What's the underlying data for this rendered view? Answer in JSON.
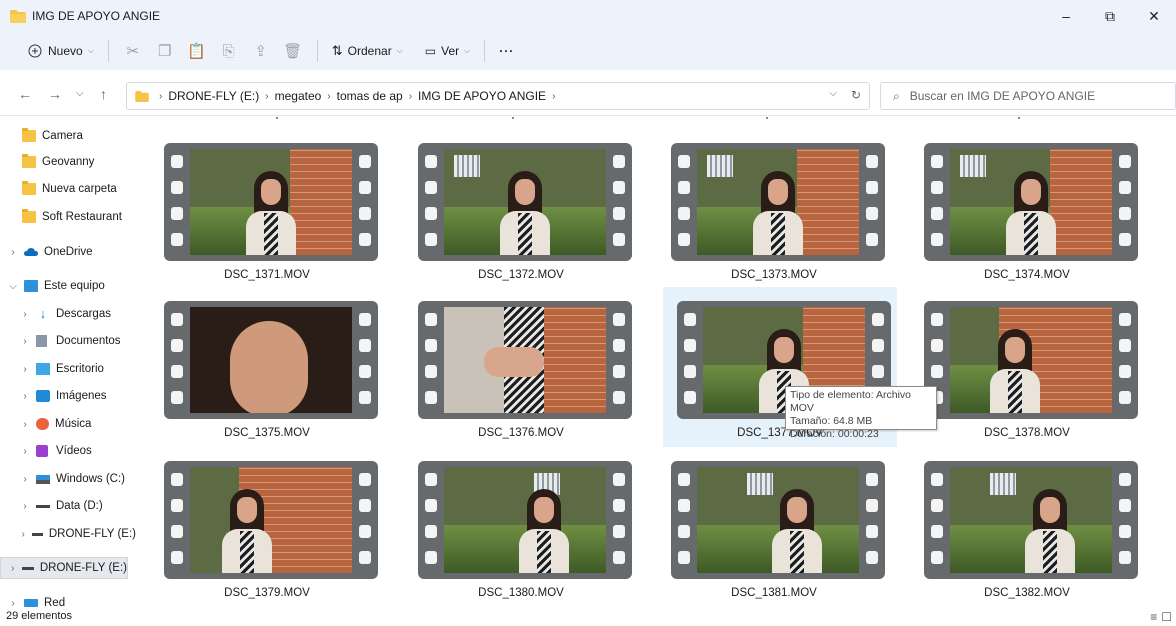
{
  "window": {
    "title": "IMG DE APOYO ANGIE",
    "minimize": "–",
    "restore": "⧉",
    "close": "✕"
  },
  "toolbar": {
    "new_label": "Nuevo",
    "sort_label": "Ordenar",
    "view_label": "Ver",
    "more": "···"
  },
  "address": {
    "crumbs": [
      "DRONE-FLY (E:)",
      "megateo",
      "tomas de ap",
      "IMG DE APOYO ANGIE"
    ],
    "search_placeholder": "Buscar en IMG DE APOYO ANGIE"
  },
  "sidebar": {
    "items": [
      {
        "label": "Camera"
      },
      {
        "label": "Geovanny"
      },
      {
        "label": "Nueva carpeta"
      },
      {
        "label": "Soft Restaurant"
      },
      {
        "label": "OneDrive"
      },
      {
        "label": "Este equipo"
      },
      {
        "label": "Descargas"
      },
      {
        "label": "Documentos"
      },
      {
        "label": "Escritorio"
      },
      {
        "label": "Imágenes"
      },
      {
        "label": "Música"
      },
      {
        "label": "Vídeos"
      },
      {
        "label": "Windows (C:)"
      },
      {
        "label": "Data (D:)"
      },
      {
        "label": "DRONE-FLY (E:)"
      },
      {
        "label": "DRONE-FLY (E:)"
      },
      {
        "label": "Red"
      }
    ]
  },
  "files": [
    {
      "name": "DSC_1371.MOV"
    },
    {
      "name": "DSC_1372.MOV"
    },
    {
      "name": "DSC_1373.MOV"
    },
    {
      "name": "DSC_1374.MOV"
    },
    {
      "name": "DSC_1375.MOV"
    },
    {
      "name": "DSC_1376.MOV"
    },
    {
      "name": "DSC_1377.MOV"
    },
    {
      "name": "DSC_1378.MOV"
    },
    {
      "name": "DSC_1379.MOV"
    },
    {
      "name": "DSC_1380.MOV"
    },
    {
      "name": "DSC_1381.MOV"
    },
    {
      "name": "DSC_1382.MOV"
    }
  ],
  "tooltip": {
    "type": "Tipo de elemento: Archivo MOV",
    "size": "Tamaño: 64.8 MB",
    "duration": "Duración: 00:00:23"
  },
  "status": {
    "count": "29 elementos"
  },
  "colors": {
    "titlebar_bg": "#eef3fb",
    "hover_bg": "#e5f1fb",
    "folder_yellow": "#f6c344",
    "accent_blue": "#0067c0"
  }
}
